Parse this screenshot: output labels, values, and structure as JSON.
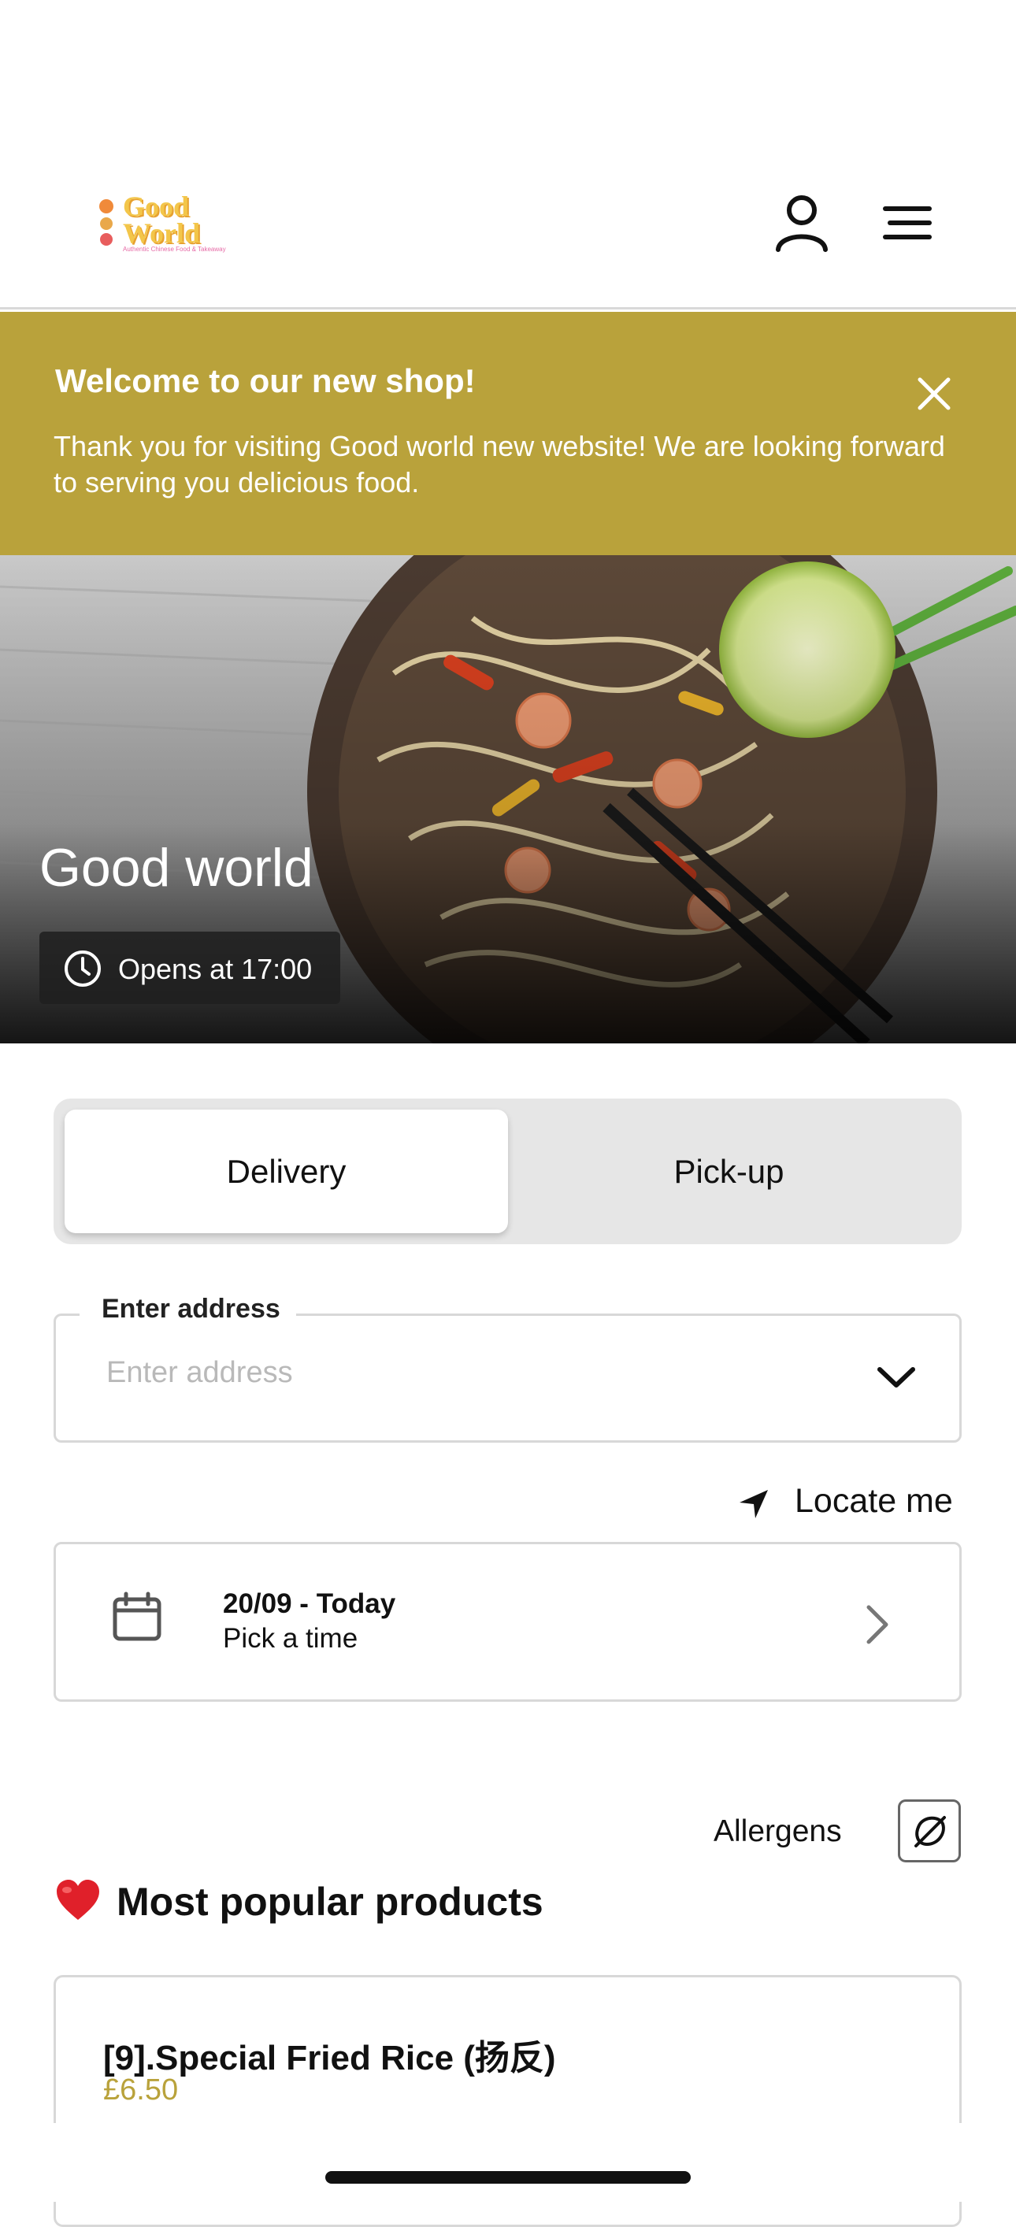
{
  "header": {
    "logo": {
      "line1": "Good",
      "line2": "World",
      "tagline": "Authentic Chinese Food & Takeaway"
    },
    "account_icon": "user-icon",
    "menu_icon": "hamburger-menu-icon"
  },
  "banner": {
    "title": "Welcome to our new shop!",
    "text": "Thank you for visiting Good world new website! We are looking forward to serving you delicious food.",
    "close_icon": "close-icon",
    "color": "#b9a23b"
  },
  "hero": {
    "title": "Good world",
    "hours": "Opens at 17:00",
    "clock_icon": "clock-icon"
  },
  "order_mode": {
    "options": [
      "Delivery",
      "Pick-up"
    ],
    "selected": "Delivery"
  },
  "address": {
    "label": "Enter address",
    "placeholder": "Enter address",
    "value": ""
  },
  "locate": {
    "label": "Locate me",
    "icon": "location-arrow-icon"
  },
  "schedule": {
    "date": "20/09 - Today",
    "time_prompt": "Pick a time",
    "icon": "calendar-icon"
  },
  "allergens": {
    "label": "Allergens",
    "icon": "allergen-filter-icon"
  },
  "popular": {
    "title": "Most popular products",
    "icon": "heart-icon",
    "products": [
      {
        "name": "[9].Special Fried Rice (扬反)",
        "price": "£6.50"
      }
    ]
  },
  "accent_color": "#b9a23b"
}
